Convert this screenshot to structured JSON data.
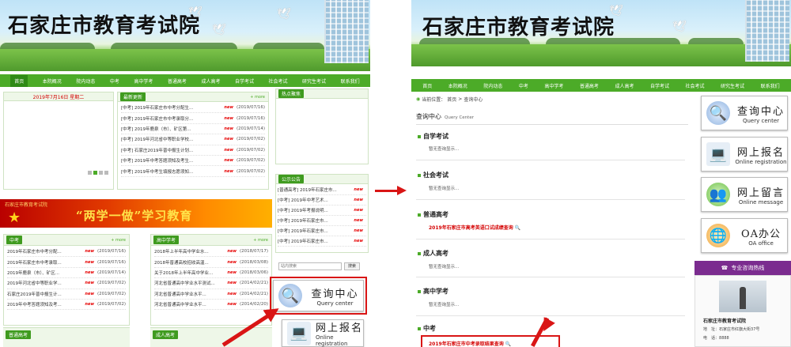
{
  "left": {
    "site_title": "石家庄市教育考试院",
    "nav": [
      "首页",
      "本院概况",
      "院内动态",
      "中考",
      "高中学考",
      "普通高考",
      "成人高考",
      "自学考试",
      "社会考试",
      "研究生考试",
      "联系我们"
    ],
    "date": "2019年7月16日 星期二",
    "slide_dots": [
      "•",
      "•",
      "•",
      "•"
    ],
    "latest": {
      "tab": "最新更新",
      "more": "+ more",
      "items": [
        {
          "t": "[中考] 2019年石家庄市中考分配生...",
          "d": "(2019/07/16)"
        },
        {
          "t": "[中考] 2019年石家庄市中考录取分...",
          "d": "(2019/07/16)"
        },
        {
          "t": "[中考] 2019年鹿泉（市）、矿区第...",
          "d": "(2019/07/14)"
        },
        {
          "t": "[中考] 2019年河北省中等职业学校...",
          "d": "(2019/07/02)"
        },
        {
          "t": "[中考] 石家庄2019年普中报生计划...",
          "d": "(2019/07/02)"
        },
        {
          "t": "[中考] 2019年中考答题须知及考生...",
          "d": "(2019/07/02)"
        },
        {
          "t": "[中考] 2019年中考生填报志愿须知...",
          "d": "(2019/07/02)"
        }
      ]
    },
    "hot": {
      "tab": "热点聚焦"
    },
    "notice": {
      "tab": "公示公告",
      "items": [
        "[普通高考] 2019年石家庄市...",
        "[中考] 2019年中考艺术...",
        "[中考] 2019年考报说明...",
        "[中考] 2019年石家庄市...",
        "[中考] 2019年石家庄市...",
        "[中考] 2019年石家庄市..."
      ]
    },
    "edu_small": "石家庄市教育考试院",
    "edu_big": "“两学一做”学习教育",
    "zhongkao": {
      "tab": "中考",
      "more": "+ more",
      "items": [
        {
          "t": "2019年石家庄市中考分配...",
          "d": "(2019/07/16)"
        },
        {
          "t": "2019年石家庄市中考录取...",
          "d": "(2019/07/16)"
        },
        {
          "t": "2019年鹿泉（市）、矿区...",
          "d": "(2019/07/14)"
        },
        {
          "t": "2019年河北省中等职业学...",
          "d": "(2019/07/02)"
        },
        {
          "t": "石家庄2019年普中报生计...",
          "d": "(2019/07/02)"
        },
        {
          "t": "2019年中考答题须知及考...",
          "d": "(2019/07/02)"
        }
      ]
    },
    "gaozhong": {
      "tab": "高中学考",
      "more": "+ more",
      "items": [
        {
          "t": "2018年上半年高中学业水...",
          "d": "(2018/07/17)"
        },
        {
          "t": "2018年普通高校招收高温...",
          "d": "(2018/03/08)"
        },
        {
          "t": "关于2018年上半年高中学业...",
          "d": "(2018/03/06)"
        },
        {
          "t": "河北省普通高中学业水平测试...",
          "d": "(2014/02/21)"
        },
        {
          "t": "河北省普通高中学业水平...",
          "d": "(2014/02/21)"
        },
        {
          "t": "河北省普通高中学业水平...",
          "d": "(2014/02/20)"
        }
      ]
    },
    "putong_tab": "普通高考",
    "chengren_tab": "成人高考",
    "search_placeholder": "站内搜索",
    "search_button": "搜索",
    "query_cn": "查询中心",
    "query_en": "Query center",
    "online_cn": "网上报名",
    "online_en": "Online registration",
    "new_badge": "new"
  },
  "right": {
    "site_title": "石家庄市教育考试院",
    "nav": [
      "首页",
      "本院概况",
      "院内动态",
      "中考",
      "高中学考",
      "普通高考",
      "成人高考",
      "自学考试",
      "社会考试",
      "研究生考试",
      "联系我们"
    ],
    "breadcrumb_label": "当前位置：",
    "breadcrumb_home": "首页",
    "breadcrumb_sep": ">",
    "breadcrumb_current": "查询中心",
    "heading_cn": "查询中心",
    "heading_en": "Query Center",
    "sections": [
      {
        "title": "自学考试",
        "text": "暂无查询显示..."
      },
      {
        "title": "社会考试",
        "text": "暂无查询显示..."
      },
      {
        "title": "普通高考",
        "link": "2019年石家庄市高考英语口试成绩查询"
      },
      {
        "title": "成人高考",
        "text": "暂无查询显示..."
      },
      {
        "title": "高中学考",
        "text": "暂无查询显示..."
      },
      {
        "title": "中考",
        "link": "2019年石家庄市中考录取结果查询"
      }
    ],
    "side": [
      {
        "cn": "查询中心",
        "en": "Query center"
      },
      {
        "cn": "网上报名",
        "en": "Online registration"
      },
      {
        "cn": "网上留言",
        "en": "Online message"
      },
      {
        "cn": "OA办公",
        "en": "OA office"
      }
    ],
    "hotline": "专业咨询热线",
    "org_name": "石家庄市教育考试院",
    "addr_label": "地　址：",
    "addr": "石家庄市红旗大街37号",
    "phone_label": "电　话：",
    "phone": "8888"
  },
  "colors": {
    "nav_green": "#4cab28",
    "highlight_red": "#d91515",
    "link_red": "#d40000"
  }
}
